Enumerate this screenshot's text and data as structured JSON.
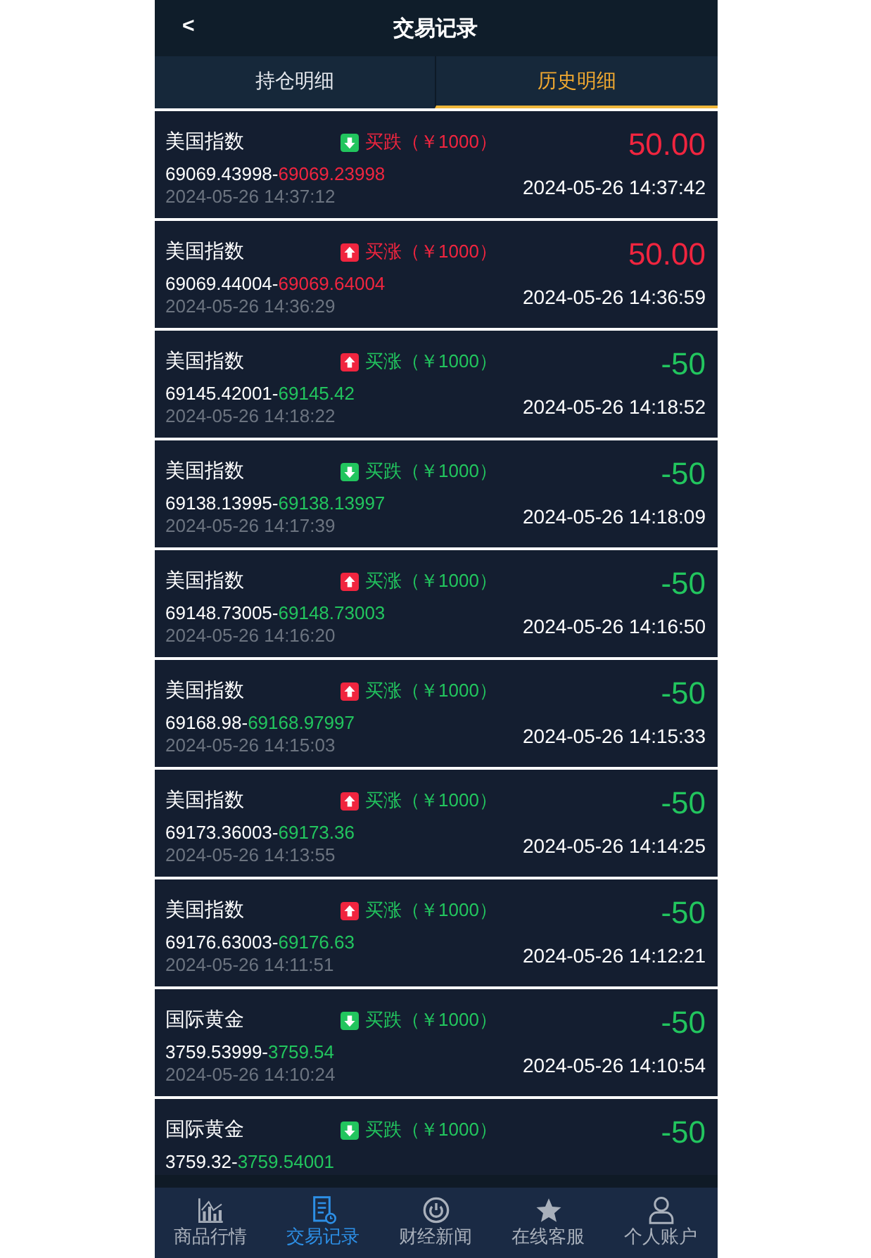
{
  "header": {
    "back": "<",
    "title": "交易记录"
  },
  "tabs": [
    {
      "label": "持仓明细",
      "selected": false
    },
    {
      "label": "历史明细",
      "selected": true
    }
  ],
  "trades": [
    {
      "name": "美国指数",
      "up": false,
      "kind": "profit",
      "trade": "买跌（￥1000）",
      "open_price": "69069.43998-",
      "close_price": "69069.23998",
      "open_time": "2024-05-26 14:37:12",
      "profit": "50.00",
      "close_time": "2024-05-26 14:37:42"
    },
    {
      "name": "美国指数",
      "up": true,
      "kind": "profit",
      "trade": "买涨（￥1000）",
      "open_price": "69069.44004-",
      "close_price": "69069.64004",
      "open_time": "2024-05-26 14:36:29",
      "profit": "50.00",
      "close_time": "2024-05-26 14:36:59"
    },
    {
      "name": "美国指数",
      "up": true,
      "kind": "loss",
      "trade": "买涨（￥1000）",
      "open_price": "69145.42001-",
      "close_price": "69145.42",
      "open_time": "2024-05-26 14:18:22",
      "profit": "-50",
      "close_time": "2024-05-26 14:18:52"
    },
    {
      "name": "美国指数",
      "up": false,
      "kind": "loss",
      "trade": "买跌（￥1000）",
      "open_price": "69138.13995-",
      "close_price": "69138.13997",
      "open_time": "2024-05-26 14:17:39",
      "profit": "-50",
      "close_time": "2024-05-26 14:18:09"
    },
    {
      "name": "美国指数",
      "up": true,
      "kind": "loss",
      "trade": "买涨（￥1000）",
      "open_price": "69148.73005-",
      "close_price": "69148.73003",
      "open_time": "2024-05-26 14:16:20",
      "profit": "-50",
      "close_time": "2024-05-26 14:16:50"
    },
    {
      "name": "美国指数",
      "up": true,
      "kind": "loss",
      "trade": "买涨（￥1000）",
      "open_price": "69168.98-",
      "close_price": "69168.97997",
      "open_time": "2024-05-26 14:15:03",
      "profit": "-50",
      "close_time": "2024-05-26 14:15:33"
    },
    {
      "name": "美国指数",
      "up": true,
      "kind": "loss",
      "trade": "买涨（￥1000）",
      "open_price": "69173.36003-",
      "close_price": "69173.36",
      "open_time": "2024-05-26 14:13:55",
      "profit": "-50",
      "close_time": "2024-05-26 14:14:25"
    },
    {
      "name": "美国指数",
      "up": true,
      "kind": "loss",
      "trade": "买涨（￥1000）",
      "open_price": "69176.63003-",
      "close_price": "69176.63",
      "open_time": "2024-05-26 14:11:51",
      "profit": "-50",
      "close_time": "2024-05-26 14:12:21"
    },
    {
      "name": "国际黄金",
      "up": false,
      "kind": "loss",
      "trade": "买跌（￥1000）",
      "open_price": "3759.53999-",
      "close_price": "3759.54",
      "open_time": "2024-05-26 14:10:24",
      "profit": "-50",
      "close_time": "2024-05-26 14:10:54"
    },
    {
      "name": "国际黄金",
      "up": false,
      "kind": "loss",
      "trade": "买跌（￥1000）",
      "open_price": "3759.32-",
      "close_price": "3759.54001",
      "profit": "-50"
    }
  ],
  "nav": [
    {
      "label": "商品行情",
      "selected": false
    },
    {
      "label": "交易记录",
      "selected": true
    },
    {
      "label": "财经新闻",
      "selected": false
    },
    {
      "label": "在线客服",
      "selected": false
    },
    {
      "label": "个人账户",
      "selected": false
    }
  ]
}
